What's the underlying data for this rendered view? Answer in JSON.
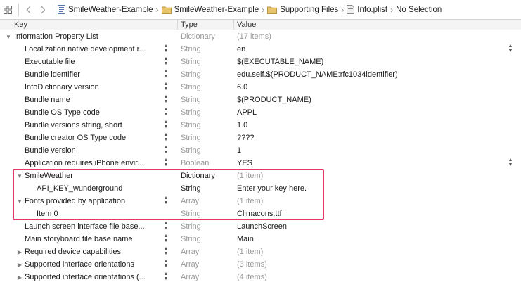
{
  "jumpbar": {
    "crumbs": [
      {
        "label": "SmileWeather-Example",
        "icon": "project-file-icon"
      },
      {
        "label": "SmileWeather-Example",
        "icon": "folder-icon"
      },
      {
        "label": "Supporting Files",
        "icon": "folder-icon"
      },
      {
        "label": "Info.plist",
        "icon": "plist-file-icon"
      },
      {
        "label": "No Selection",
        "icon": ""
      }
    ]
  },
  "header": {
    "key": "Key",
    "type": "Type",
    "value": "Value"
  },
  "root": {
    "key": "Information Property List",
    "type": "Dictionary",
    "value": "(17 items)"
  },
  "rows": [
    {
      "key": "Localization native development r...",
      "type": "String",
      "value": "en",
      "value_stepper": true
    },
    {
      "key": "Executable file",
      "type": "String",
      "value": "$(EXECUTABLE_NAME)"
    },
    {
      "key": "Bundle identifier",
      "type": "String",
      "value": "edu.self.$(PRODUCT_NAME:rfc1034identifier)"
    },
    {
      "key": "InfoDictionary version",
      "type": "String",
      "value": "6.0"
    },
    {
      "key": "Bundle name",
      "type": "String",
      "value": "$(PRODUCT_NAME)"
    },
    {
      "key": "Bundle OS Type code",
      "type": "String",
      "value": "APPL"
    },
    {
      "key": "Bundle versions string, short",
      "type": "String",
      "value": "1.0"
    },
    {
      "key": "Bundle creator OS Type code",
      "type": "String",
      "value": "????"
    },
    {
      "key": "Bundle version",
      "type": "String",
      "value": "1"
    },
    {
      "key": "Application requires iPhone envir...",
      "type": "Boolean",
      "value": "YES",
      "value_stepper": true
    },
    {
      "key": "SmileWeather",
      "type": "Dictionary",
      "value": "(1 item)",
      "disclosure": "open"
    },
    {
      "key": "API_KEY_wunderground",
      "type": "String",
      "value": "Enter your key here.",
      "child": true
    },
    {
      "key": "Fonts provided by application",
      "type": "Array",
      "value": "(1 item)",
      "disclosure": "open"
    },
    {
      "key": "Item 0",
      "type": "String",
      "value": "Climacons.ttf",
      "child": true
    },
    {
      "key": "Launch screen interface file base...",
      "type": "String",
      "value": "LaunchScreen"
    },
    {
      "key": "Main storyboard file base name",
      "type": "String",
      "value": "Main"
    },
    {
      "key": "Required device capabilities",
      "type": "Array",
      "value": "(1 item)",
      "disclosure": "closed"
    },
    {
      "key": "Supported interface orientations",
      "type": "Array",
      "value": "(3 items)",
      "disclosure": "closed"
    },
    {
      "key": "Supported interface orientations (...",
      "type": "Array",
      "value": "(4 items)",
      "disclosure": "closed"
    }
  ],
  "colors": {
    "highlight": "#e8366a",
    "muted_text": "#9a9a9a"
  }
}
